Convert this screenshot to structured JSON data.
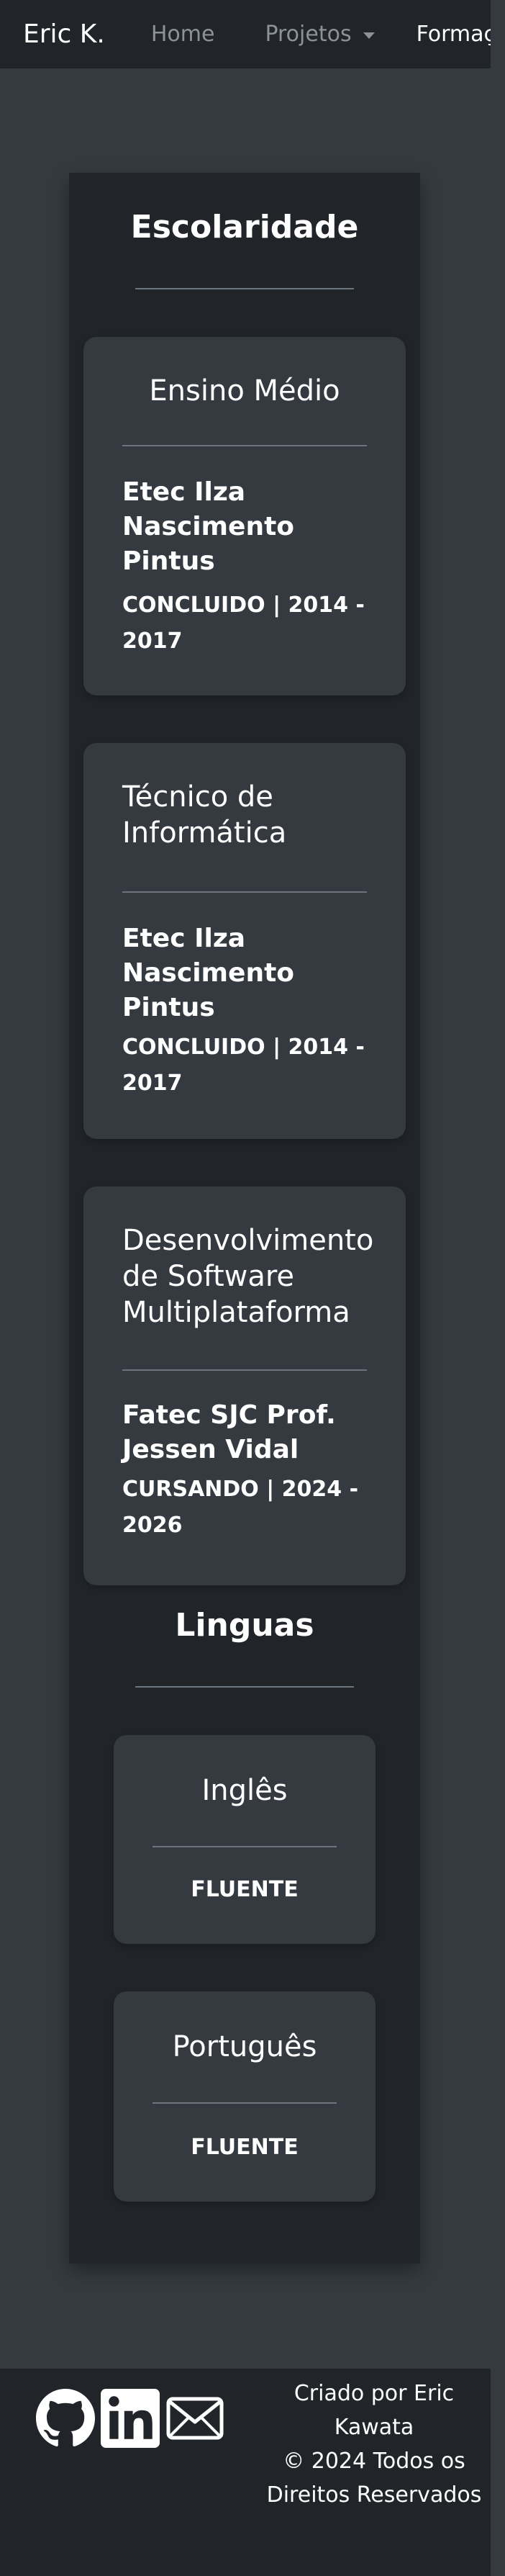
{
  "navbar": {
    "brand": "Eric K.",
    "items": [
      {
        "label": "Home"
      },
      {
        "label": "Projetos"
      },
      {
        "label": "Formação"
      }
    ]
  },
  "education": {
    "title": "Escolaridade",
    "cards": [
      {
        "course": "Ensino Médio",
        "school": "Etec Ilza Nascimento Pintus",
        "status": "CONCLUIDO | 2014 - 2017"
      },
      {
        "course": "Técnico de Informática",
        "school": "Etec Ilza Nascimento Pintus",
        "status": "CONCLUIDO | 2014 - 2017"
      },
      {
        "course": "Desenvolvimento de Software Multiplataforma",
        "school": "Fatec SJC Prof. Jessen Vidal",
        "status": "CURSANDO | 2024 - 2026"
      }
    ]
  },
  "languages": {
    "title": "Linguas",
    "cards": [
      {
        "language": "Inglês",
        "level": "FLUENTE"
      },
      {
        "language": "Português",
        "level": "FLUENTE"
      }
    ]
  },
  "footer": {
    "credit": "Criado por Eric Kawata",
    "copyright": "© 2024 Todos os Direitos Reservados",
    "social_icons": [
      "github-icon",
      "linkedin-icon",
      "email-icon"
    ]
  },
  "colors": {
    "background": "#343a40",
    "surface": "#212529",
    "card": "#343a40",
    "nav_inactive": "#8c9298",
    "rule": "#6c757d"
  }
}
